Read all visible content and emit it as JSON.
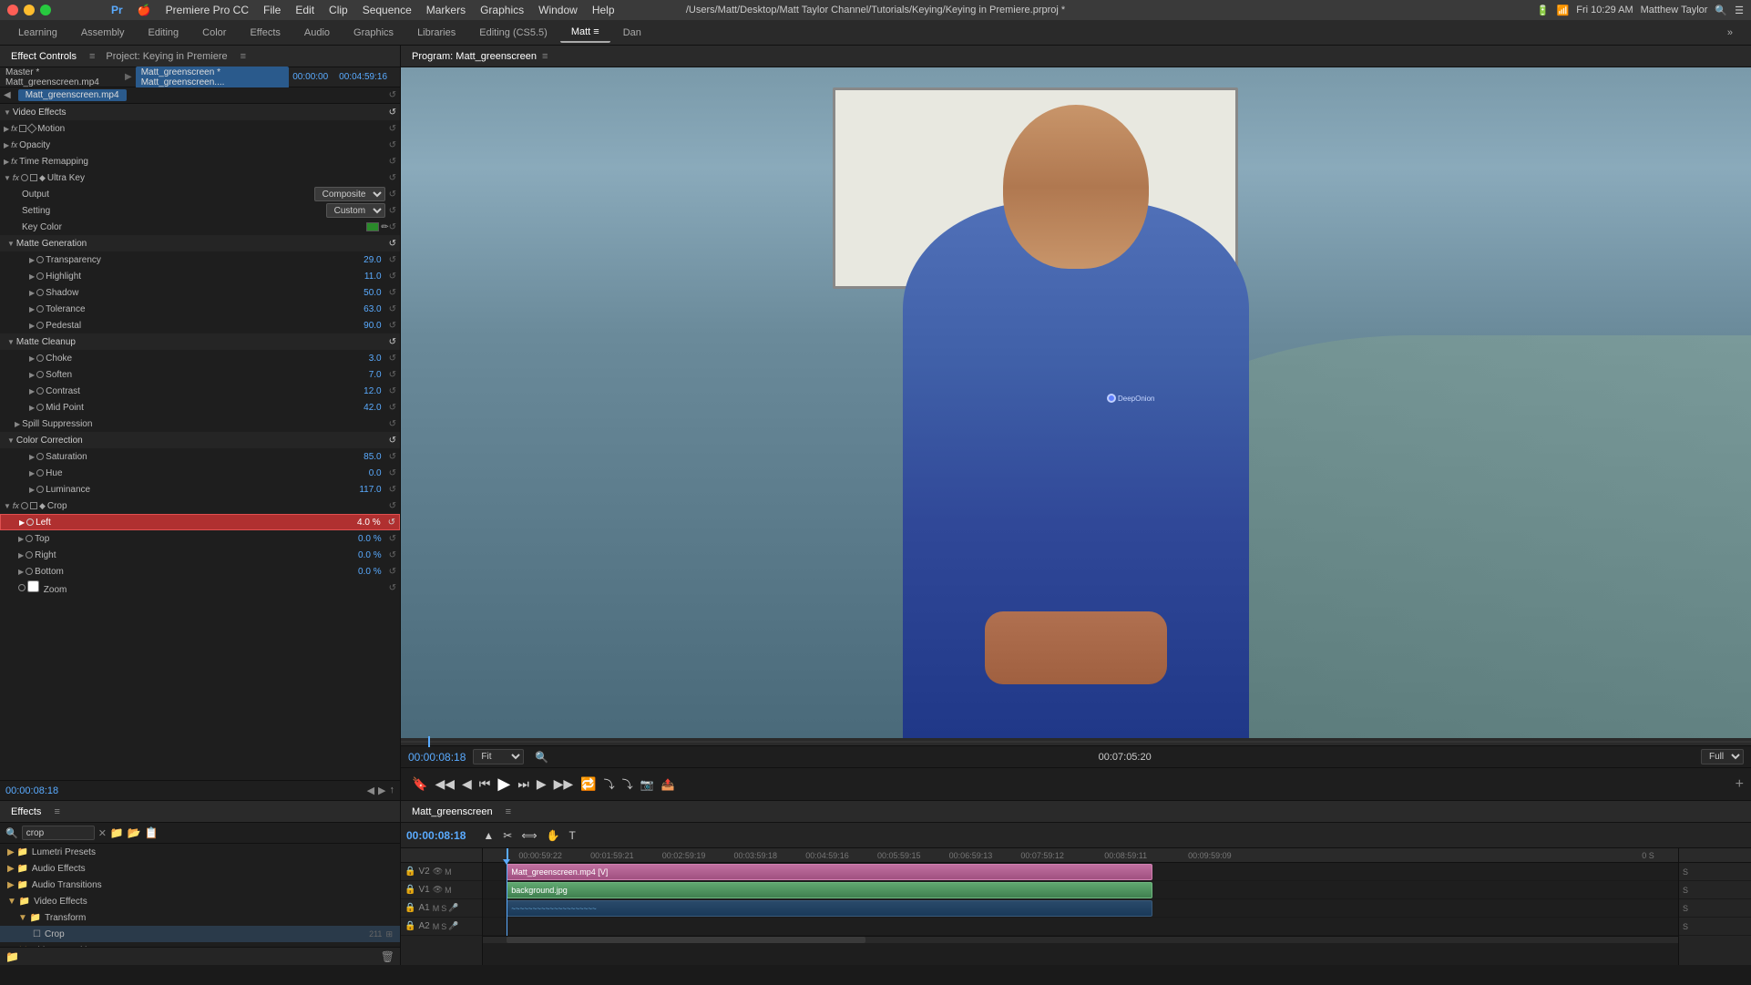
{
  "os": {
    "title": "/Users/Matt/Desktop/Matt Taylor Channel/Tutorials/Keying/Keying in Premiere.prproj *",
    "time": "Fri 10:29 AM",
    "user": "Matthew Taylor"
  },
  "app": {
    "name": "Premiere Pro CC",
    "menu": [
      "File",
      "Edit",
      "Clip",
      "Sequence",
      "Markers",
      "Graphics",
      "Window",
      "Help"
    ]
  },
  "workspace_tabs": [
    "Learning",
    "Assembly",
    "Editing",
    "Color",
    "Effects",
    "Audio",
    "Graphics",
    "Libraries",
    "Editing (CS5.5)",
    "Matt",
    "Dan",
    "»"
  ],
  "active_workspace": "Matt",
  "effect_controls": {
    "title": "Effect Controls",
    "project_tab": "Project: Keying in Premiere",
    "source": "Master * Matt_greenscreen.mp4",
    "clip": "Matt_greenscreen * Matt_greenscreen....",
    "timecode_in": "00:00:00",
    "timecode_out": "00:04:59:16",
    "clip_label": "Matt_greenscreen.mp4",
    "video_effects_label": "Video Effects",
    "effects": [
      {
        "name": "Motion",
        "level": 0,
        "has_arrow": true,
        "fx": true,
        "icons": [
          "motion"
        ]
      },
      {
        "name": "Opacity",
        "level": 0,
        "has_arrow": true,
        "fx": true
      },
      {
        "name": "Time Remapping",
        "level": 0,
        "has_arrow": true,
        "fx": true
      },
      {
        "name": "Ultra Key",
        "level": 0,
        "has_arrow": true,
        "fx": true,
        "is_section": false
      },
      {
        "name": "Output",
        "level": 1,
        "value": "Composite",
        "dropdown": true
      },
      {
        "name": "Setting",
        "level": 1,
        "value": "Custom",
        "dropdown": true
      },
      {
        "name": "Key Color",
        "level": 1,
        "has_color": true
      },
      {
        "name": "Matte Generation",
        "level": 0,
        "is_section": true
      },
      {
        "name": "Transparency",
        "level": 1,
        "has_arrow": true,
        "value": "29.0"
      },
      {
        "name": "Highlight",
        "level": 1,
        "has_arrow": true,
        "value": "11.0"
      },
      {
        "name": "Shadow",
        "level": 1,
        "has_arrow": true,
        "value": "50.0"
      },
      {
        "name": "Tolerance",
        "level": 1,
        "has_arrow": true,
        "value": "63.0"
      },
      {
        "name": "Pedestal",
        "level": 1,
        "has_arrow": true,
        "value": "90.0"
      },
      {
        "name": "Matte Cleanup",
        "level": 0,
        "is_section": true
      },
      {
        "name": "Choke",
        "level": 1,
        "has_arrow": true,
        "value": "3.0"
      },
      {
        "name": "Soften",
        "level": 1,
        "has_arrow": true,
        "value": "7.0"
      },
      {
        "name": "Contrast",
        "level": 1,
        "has_arrow": true,
        "value": "12.0"
      },
      {
        "name": "Mid Point",
        "level": 1,
        "has_arrow": true,
        "value": "42.0"
      },
      {
        "name": "Spill Suppression",
        "level": 0,
        "is_subsection": true
      },
      {
        "name": "Color Correction",
        "level": 0,
        "is_section": true
      },
      {
        "name": "Saturation",
        "level": 1,
        "has_arrow": true,
        "value": "85.0"
      },
      {
        "name": "Hue",
        "level": 1,
        "has_arrow": true,
        "value": "0.0"
      },
      {
        "name": "Luminance",
        "level": 1,
        "has_arrow": true,
        "value": "117.0"
      },
      {
        "name": "Crop",
        "level": 0,
        "has_arrow": true,
        "fx": true,
        "is_section": false
      },
      {
        "name": "Left",
        "level": 1,
        "has_arrow": true,
        "value": "4.0 %",
        "highlighted": true
      },
      {
        "name": "Top",
        "level": 1,
        "has_arrow": true,
        "value": "0.0 %"
      },
      {
        "name": "Right",
        "level": 1,
        "has_arrow": true,
        "value": "0.0 %"
      },
      {
        "name": "Bottom",
        "level": 1,
        "has_arrow": true,
        "value": "0.0 %"
      },
      {
        "name": "Zoom",
        "level": 1,
        "has_checkbox": true
      }
    ],
    "timecode": "00:00:08:18"
  },
  "program_monitor": {
    "title": "Program: Matt_greenscreen",
    "timecode": "00:00:08:18",
    "fit": "Fit",
    "quality": "Full",
    "duration": "00:07:05:20"
  },
  "effects_panel": {
    "title": "Effects",
    "search_placeholder": "crop",
    "search_value": "crop",
    "items": [
      {
        "type": "preset",
        "label": "Lumetri Presets",
        "level": 0
      },
      {
        "type": "folder",
        "label": "Audio Effects",
        "level": 0
      },
      {
        "type": "folder",
        "label": "Audio Transitions",
        "level": 0
      },
      {
        "type": "folder",
        "label": "Video Effects",
        "level": 0
      },
      {
        "type": "folder",
        "label": "Transform",
        "level": 1
      },
      {
        "type": "effect",
        "label": "Crop",
        "level": 2,
        "badge1": "211",
        "badge2": "⊞"
      },
      {
        "type": "folder",
        "label": "Video Transitions",
        "level": 0
      }
    ]
  },
  "timeline": {
    "title": "Matt_greenscreen",
    "timecode": "00:00:08:18",
    "tracks": [
      {
        "label": "V2",
        "type": "video"
      },
      {
        "label": "V1",
        "type": "video"
      },
      {
        "label": "A1",
        "type": "audio"
      },
      {
        "label": "A2",
        "type": "audio"
      }
    ],
    "clips": [
      {
        "track": 0,
        "label": "Matt_greenscreen.mp4 [V]",
        "color": "pink",
        "left": "3%",
        "width": "55%"
      },
      {
        "track": 1,
        "label": "background.jpg",
        "color": "green",
        "left": "3%",
        "width": "55%"
      },
      {
        "track": 2,
        "label": "",
        "color": "blue-audio",
        "left": "3%",
        "width": "55%"
      },
      {
        "track": 3,
        "label": "",
        "color": "blue-audio",
        "left": "3%",
        "width": "55%"
      }
    ],
    "ruler_marks": [
      "00:00:59:22",
      "00:01:59:21",
      "00:02:59:19",
      "00:03:59:18",
      "00:04:59:16",
      "00:05:59:15",
      "00:06:59:13",
      "00:07:59:12",
      "00:08:59:11",
      "00:09:59:09",
      "0 S"
    ]
  }
}
